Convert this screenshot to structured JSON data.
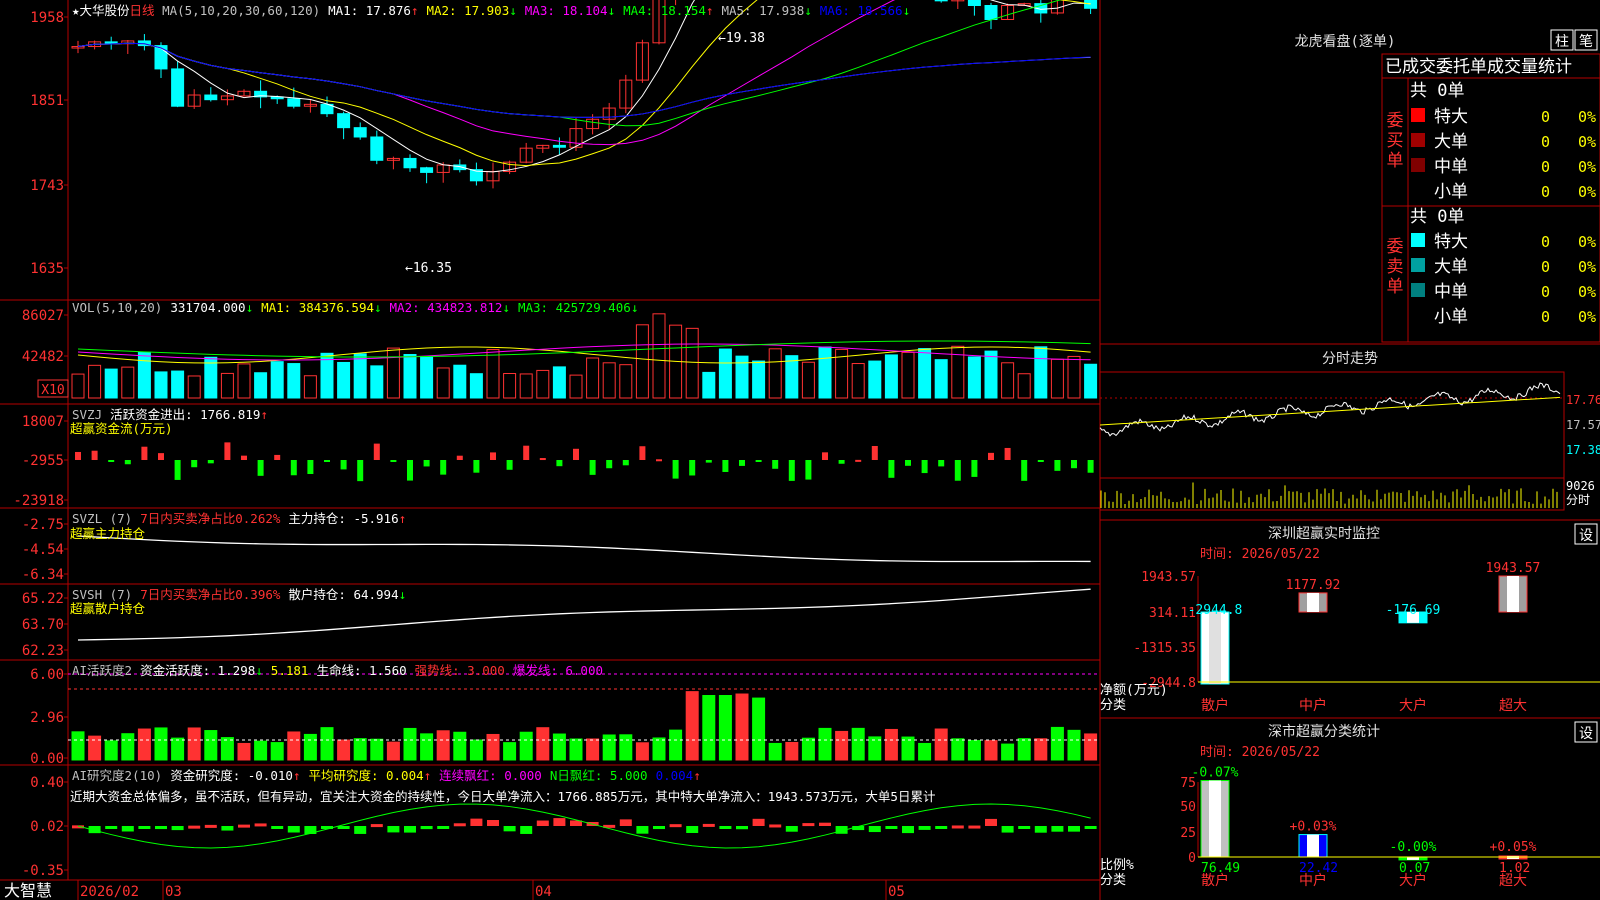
{
  "stock": {
    "name": "★大华股份",
    "period": "日线"
  },
  "colors": {
    "up": "#ff3232",
    "down": "#00ffff",
    "axis": "#b40000",
    "ma1": "#ffffff",
    "ma2": "#ffff00",
    "ma3": "#ff00ff",
    "ma4": "#00ff00",
    "ma5": "#c0c0c0",
    "ma6": "#0000ff",
    "green": "#00ff00"
  },
  "main_panel": {
    "ma_header": [
      {
        "text": "MA(5,10,20,30,60,120)",
        "color": "#c0c0c0"
      },
      {
        "text": "MA1: 17.876",
        "color": "#ffffff",
        "arrow": "↑"
      },
      {
        "text": "MA2: 17.903",
        "color": "#ffff00",
        "arrow": "↓"
      },
      {
        "text": "MA3: 18.104",
        "color": "#ff00ff",
        "arrow": "↓"
      },
      {
        "text": "MA4: 18.154",
        "color": "#00ff00",
        "arrow": "↑"
      },
      {
        "text": "MA5: 17.938",
        "color": "#c0c0c0",
        "arrow": "↓"
      },
      {
        "text": "MA6: 18.566",
        "color": "#0000ff",
        "arrow": "↓"
      }
    ],
    "y_ticks": [
      "1958",
      "1851",
      "1743",
      "1635"
    ],
    "high_label": "19.38",
    "low_label": "16.35"
  },
  "vol_panel": {
    "header": [
      {
        "text": "VOL(5,10,20)",
        "color": "#c0c0c0"
      },
      {
        "text": "331704.000",
        "color": "#ffffff",
        "arrow": "↓"
      },
      {
        "text": "MA1: 384376.594",
        "color": "#ffff00",
        "arrow": "↓"
      },
      {
        "text": "MA2: 434823.812",
        "color": "#ff00ff",
        "arrow": "↓"
      },
      {
        "text": "MA3: 425729.406",
        "color": "#00ff00",
        "arrow": "↓"
      }
    ],
    "y_ticks": [
      "86027",
      "42482"
    ],
    "unit": "X10"
  },
  "svzj_panel": {
    "header": [
      {
        "text": "SVZJ",
        "color": "#c0c0c0"
      },
      {
        "text": "活跃资金进出: 1766.819",
        "color": "#ffffff",
        "arrow": "↑"
      }
    ],
    "subtitle": "超赢资金流(万元)",
    "y_ticks": [
      "18007",
      "-2955",
      "-23918"
    ]
  },
  "svzl_panel": {
    "header": [
      {
        "text": "SVZL (7)",
        "color": "#c0c0c0"
      },
      {
        "text": "7日内买卖净占比0.262%",
        "color": "#ff3232"
      },
      {
        "text": "主力持仓: -5.916",
        "color": "#ffffff",
        "arrow": "↑"
      }
    ],
    "subtitle": "超赢主力持仓",
    "y_ticks": [
      "-2.75",
      "-4.54",
      "-6.34"
    ]
  },
  "svsh_panel": {
    "header": [
      {
        "text": "SVSH (7)",
        "color": "#c0c0c0"
      },
      {
        "text": "7日内买卖净占比0.396%",
        "color": "#ff3232"
      },
      {
        "text": "散户持仓: 64.994",
        "color": "#ffffff",
        "arrow": "↓"
      }
    ],
    "subtitle": "超赢散户持仓",
    "y_ticks": [
      "65.22",
      "63.70",
      "62.23"
    ]
  },
  "ai_act_panel": {
    "header": [
      {
        "text": "AI活跃度2",
        "color": "#c0c0c0"
      },
      {
        "text": "资金活跃度: 1.298",
        "color": "#ffffff",
        "arrow": "↓"
      },
      {
        "text": "5.181",
        "color": "#ffff00"
      },
      {
        "text": "生命线: 1.560",
        "color": "#ffffff"
      },
      {
        "text": "强势线: 3.000",
        "color": "#ff3232"
      },
      {
        "text": "爆发线: 6.000",
        "color": "#ff00ff"
      }
    ],
    "y_ticks": [
      "6.00",
      "2.96",
      "0.00"
    ]
  },
  "ai_res_panel": {
    "header": [
      {
        "text": "AI研究度2(10)",
        "color": "#c0c0c0"
      },
      {
        "text": "资金研究度: -0.010",
        "color": "#ffffff",
        "arrow": "↑"
      },
      {
        "text": "平均研究度: 0.004",
        "color": "#ffff00",
        "arrow": "↑"
      },
      {
        "text": "连续飘红: 0.000",
        "color": "#ff00ff"
      },
      {
        "text": "N日飘红: 5.000",
        "color": "#00ff00"
      },
      {
        "text": "0.004",
        "color": "#0000ff",
        "arrow": "↑"
      }
    ],
    "comment": "近期大资金总体偏多，虽不活跃，但有异动，宜关注大资金的持续性，今日大单净流入：1766.885万元，其中特大单净流入：1943.573万元，大单5日累计",
    "y_ticks": [
      "0.40",
      "0.02",
      "-0.35"
    ]
  },
  "bottom_bar": {
    "brand": "大智慧",
    "dates": [
      "2026/02",
      "03",
      "04",
      "05"
    ]
  },
  "dragon_panel": {
    "title": "龙虎看盘(逐单)",
    "btn_bar": "柱",
    "btn_pen": "笔",
    "stat_title": "已成交委托单成交量统计",
    "buy_label": "委买单",
    "sell_label": "委卖单",
    "buy_total": "共 0单",
    "sell_total": "共 0单",
    "buy_rows": [
      {
        "label": "特大",
        "value": "0",
        "pct": "0%",
        "color": "#ff0000"
      },
      {
        "label": "大单",
        "value": "0",
        "pct": "0%",
        "color": "#a00000"
      },
      {
        "label": "中单",
        "value": "0",
        "pct": "0%",
        "color": "#800000"
      },
      {
        "label": "小单",
        "value": "0",
        "pct": "0%",
        "color": ""
      }
    ],
    "sell_rows": [
      {
        "label": "特大",
        "value": "0",
        "pct": "0%",
        "color": "#00ffff"
      },
      {
        "label": "大单",
        "value": "0",
        "pct": "0%",
        "color": "#00a0a0"
      },
      {
        "label": "中单",
        "value": "0",
        "pct": "0%",
        "color": "#008080"
      },
      {
        "label": "小单",
        "value": "0",
        "pct": "0%",
        "color": ""
      }
    ]
  },
  "intraday_panel": {
    "title": "分时走势",
    "y_ticks": [
      {
        "text": "17.76",
        "color": "#ff3232"
      },
      {
        "text": "17.57",
        "color": "#c0c0c0"
      },
      {
        "text": "17.38",
        "color": "#00ffff"
      }
    ],
    "vol_tick": "9026",
    "vol_label": "分时"
  },
  "monitor_panel": {
    "title": "深圳超赢实时监控",
    "settings": "设",
    "time": "时间: 2026/05/22",
    "y_ticks": [
      "1943.57",
      "314.11",
      "-1315.35",
      "-2944.8"
    ],
    "unit_label": "净额(万元)",
    "class_label": "分类",
    "chart_data": {
      "type": "bar",
      "categories": [
        "散户",
        "中户",
        "大户",
        "超大"
      ],
      "values": [
        -2944.8,
        1177.92,
        -176.69,
        1943.57
      ],
      "value_labels": [
        "-2944.8",
        "1177.92",
        "-176.69",
        "1943.57"
      ],
      "ylim": [
        -2944.8,
        1943.57
      ]
    }
  },
  "class_panel": {
    "title": "深市超赢分类统计",
    "settings": "设",
    "time": "时间: 2026/05/22",
    "y_ticks": [
      "75",
      "50",
      "25",
      "0"
    ],
    "unit_label": "比例%",
    "class_label": "分类",
    "chart_data": {
      "type": "bar",
      "categories": [
        "散户",
        "中户",
        "大户",
        "超大"
      ],
      "values": [
        76.49,
        22.42,
        0.07,
        1.02
      ],
      "value_labels": [
        "76.49",
        "22.42",
        "0.07",
        "1.02"
      ],
      "change_labels": [
        "-0.07%",
        "+0.03%",
        "-0.00%",
        "+0.05%"
      ],
      "ylim": [
        0,
        75
      ]
    }
  }
}
